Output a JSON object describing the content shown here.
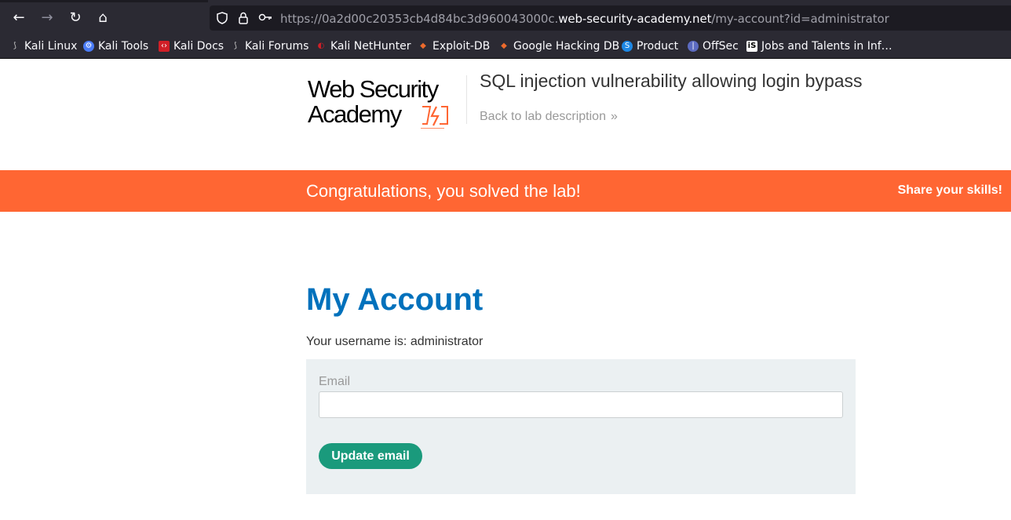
{
  "browser": {
    "url_prefix": "https://0a2d00c20353cb4d84bc3d960043000c.",
    "url_host": "web-security-academy.net",
    "url_path": "/my-account?id=administrator",
    "nav": {
      "back_icon": "arrow-left-icon",
      "forward_icon": "arrow-right-icon",
      "reload_icon": "reload-icon",
      "home_icon": "home-icon"
    },
    "bookmarks": [
      {
        "label": "Kali Linux",
        "icon": "kali-dragon-icon",
        "color": "#cccccc"
      },
      {
        "label": "Kali Tools",
        "icon": "kali-tools-icon",
        "color": "#4a7cf7"
      },
      {
        "label": "Kali Docs",
        "icon": "kali-docs-icon",
        "color": "#d11f27"
      },
      {
        "label": "Kali Forums",
        "icon": "kali-dragon-icon",
        "color": "#cccccc"
      },
      {
        "label": "Kali NetHunter",
        "icon": "nethunter-icon",
        "color": "#d11f27"
      },
      {
        "label": "Exploit-DB",
        "icon": "exploitdb-icon",
        "color": "#ec6a2c"
      },
      {
        "label": "Google Hacking DB",
        "icon": "ghdb-icon",
        "color": "#ec6a2c"
      },
      {
        "label": "Product",
        "icon": "product-icon",
        "color": "#1e88e5"
      },
      {
        "label": "OffSec",
        "icon": "offsec-icon",
        "color": "#5c6bc0"
      },
      {
        "label": "Jobs and Talents in Inf…",
        "icon": "is-icon",
        "color": "#ffffff"
      }
    ]
  },
  "header": {
    "logo_line1": "Web Security",
    "logo_line2": "Academy",
    "lab_title": "SQL injection vulnerability allowing login bypass",
    "back_link": "Back to lab description",
    "back_chevron": "»"
  },
  "banner": {
    "message": "Congratulations, you solved the lab!",
    "share": "Share your skills!",
    "color": "#ff6633"
  },
  "account": {
    "heading": "My Account",
    "username_text": "Your username is: administrator",
    "email_label": "Email",
    "email_value": "",
    "update_button": "Update email",
    "button_color": "#1a9a7c"
  }
}
